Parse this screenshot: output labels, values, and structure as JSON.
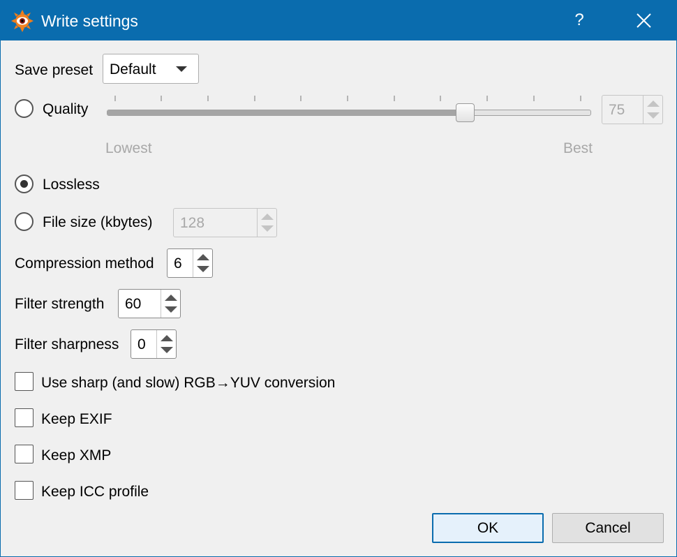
{
  "window": {
    "title": "Write settings",
    "help_label": "?",
    "accent_color": "#0a6cae"
  },
  "icons": {
    "app": "xnview-eye-icon",
    "help": "question-mark-icon",
    "close": "close-icon"
  },
  "save_preset": {
    "label": "Save preset",
    "value": "Default"
  },
  "quality": {
    "label": "Quality",
    "checked": false,
    "value": "75",
    "slider_min": 0,
    "slider_max": 100,
    "slider_value": 75,
    "tick_count": 11,
    "low_label": "Lowest",
    "high_label": "Best"
  },
  "lossless": {
    "label": "Lossless",
    "checked": true
  },
  "file_size": {
    "label": "File size (kbytes)",
    "checked": false,
    "value": "128"
  },
  "compression_method": {
    "label": "Compression method",
    "value": "6"
  },
  "filter_strength": {
    "label": "Filter strength",
    "value": "60"
  },
  "filter_sharpness": {
    "label": "Filter sharpness",
    "value": "0"
  },
  "options": [
    {
      "label": "Use sharp (and slow) RGB→YUV conversion",
      "checked": false
    },
    {
      "label": "Keep EXIF",
      "checked": false
    },
    {
      "label": "Keep XMP",
      "checked": false
    },
    {
      "label": "Keep ICC profile",
      "checked": false
    }
  ],
  "buttons": {
    "ok": "OK",
    "cancel": "Cancel"
  }
}
